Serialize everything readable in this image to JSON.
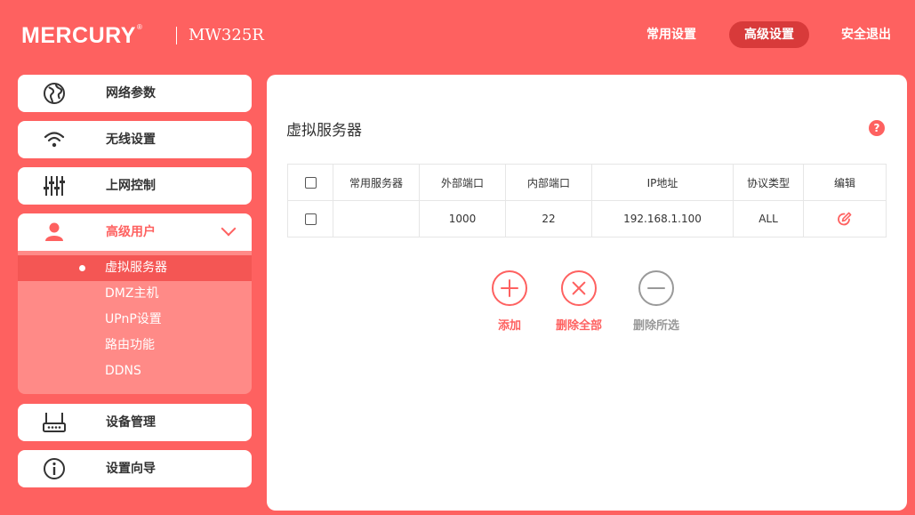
{
  "header": {
    "logo": "MERCURY",
    "logo_mark": "®",
    "model": "MW325R",
    "nav": [
      "常用设置",
      "高级设置",
      "安全退出"
    ],
    "active_nav": "高级设置"
  },
  "sidebar": {
    "items": [
      {
        "label": "网络参数",
        "icon": "globe-icon"
      },
      {
        "label": "无线设置",
        "icon": "wifi-icon"
      },
      {
        "label": "上网控制",
        "icon": "sliders-icon"
      },
      {
        "label": "高级用户",
        "icon": "user-icon"
      },
      {
        "label": "设备管理",
        "icon": "router-icon"
      },
      {
        "label": "设置向导",
        "icon": "info-icon"
      }
    ],
    "subitems": [
      "虚拟服务器",
      "DMZ主机",
      "UPnP设置",
      "路由功能",
      "DDNS"
    ],
    "active_subitem": "虚拟服务器"
  },
  "main": {
    "title": "虚拟服务器",
    "help_label": "?",
    "table": {
      "columns": [
        "常用服务器",
        "外部端口",
        "内部端口",
        "IP地址",
        "协议类型",
        "编辑"
      ],
      "rows": [
        {
          "service": "",
          "external_port": "1000",
          "internal_port": "22",
          "ip": "192.168.1.100",
          "protocol": "ALL"
        }
      ]
    },
    "actions": [
      {
        "label": "添加",
        "icon": "plus-icon",
        "enabled": true
      },
      {
        "label": "删除全部",
        "icon": "x-icon",
        "enabled": true
      },
      {
        "label": "删除所选",
        "icon": "minus-icon",
        "enabled": false
      }
    ]
  },
  "colors": {
    "accent": "#fe6160",
    "nav_active": "#d83a3a",
    "submenu_bg": "#ff8a87",
    "disabled": "#999999"
  }
}
